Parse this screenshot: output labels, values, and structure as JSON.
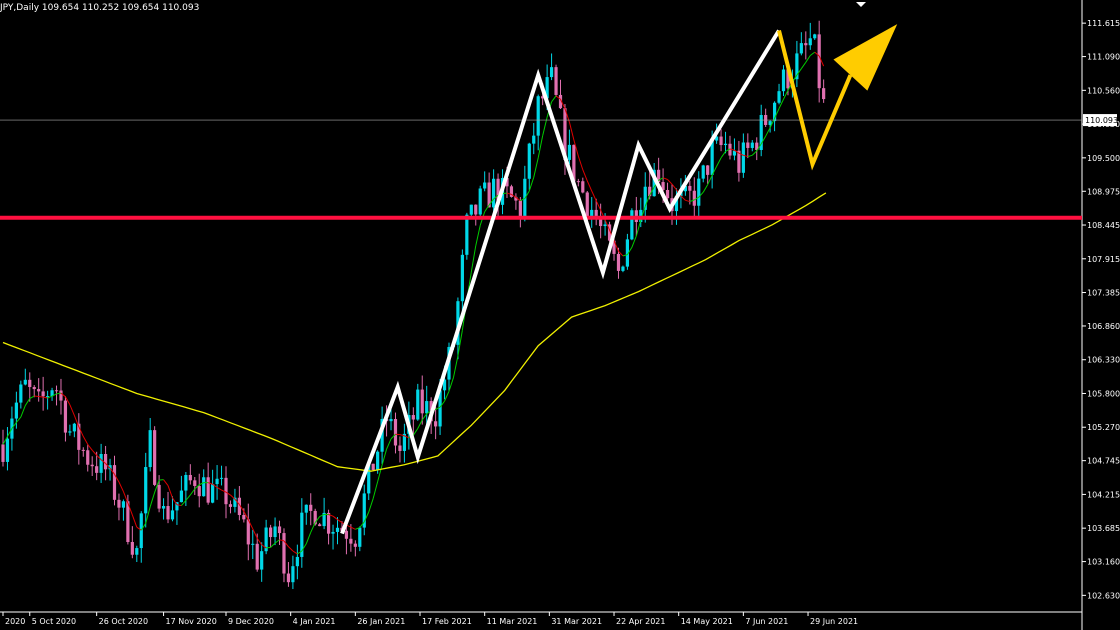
{
  "header": {
    "symbol_line": "JPY,Daily  109.654 110.252 109.654 110.093"
  },
  "chart_data": {
    "type": "candlestick",
    "title": "",
    "xlabel": "",
    "ylabel": "",
    "ylim": [
      102.4,
      111.9
    ],
    "grid": false,
    "background": "#000000",
    "colors": {
      "bull": "#00d8e8",
      "bear": "#e070b0",
      "ma_fast_up": "#00cc00",
      "ma_fast_down": "#e00000",
      "ma_slow": "#f0f000",
      "support": "#ff1040",
      "pattern": "#ffffff",
      "projection": "#ffcc00",
      "axis": "#ffffff"
    },
    "y_ticks": [
      "111.615",
      "111.090",
      "110.560",
      "110.030",
      "109.500",
      "108.975",
      "108.445",
      "107.915",
      "107.385",
      "106.860",
      "106.330",
      "105.800",
      "105.270",
      "104.745",
      "104.215",
      "103.685",
      "103.160",
      "102.630"
    ],
    "current_price": "110.093",
    "x_ticks": [
      {
        "i": 0,
        "label": "2020"
      },
      {
        "i": 12,
        "label": "5 Oct 2020"
      },
      {
        "i": 42,
        "label": "26 Oct 2020"
      },
      {
        "i": 72,
        "label": "17 Nov 2020"
      },
      {
        "i": 100,
        "label": "9 Dec 2020"
      },
      {
        "i": 129,
        "label": "4 Jan 2021"
      },
      {
        "i": 158,
        "label": "26 Jan 2021"
      },
      {
        "i": 187,
        "label": "17 Feb 2021"
      },
      {
        "i": 216,
        "label": "11 Mar 2021"
      },
      {
        "i": 245,
        "label": "31 Mar 2021"
      },
      {
        "i": 274,
        "label": "22 Apr 2021"
      },
      {
        "i": 303,
        "label": "14 May 2021"
      },
      {
        "i": 332,
        "label": "7 Jun 2021"
      },
      {
        "i": 361,
        "label": "29 Jun 2021"
      }
    ],
    "anchors": [
      {
        "i": 0,
        "p": 105.0
      },
      {
        "i": 4,
        "p": 105.5
      },
      {
        "i": 10,
        "p": 105.9
      },
      {
        "i": 16,
        "p": 105.6
      },
      {
        "i": 23,
        "p": 106.0
      },
      {
        "i": 30,
        "p": 105.2
      },
      {
        "i": 38,
        "p": 104.8
      },
      {
        "i": 46,
        "p": 104.6
      },
      {
        "i": 52,
        "p": 104.1
      },
      {
        "i": 60,
        "p": 103.3
      },
      {
        "i": 66,
        "p": 105.0
      },
      {
        "i": 72,
        "p": 103.9
      },
      {
        "i": 78,
        "p": 104.1
      },
      {
        "i": 86,
        "p": 104.5
      },
      {
        "i": 92,
        "p": 104.3
      },
      {
        "i": 100,
        "p": 104.2
      },
      {
        "i": 108,
        "p": 103.7
      },
      {
        "i": 114,
        "p": 103.2
      },
      {
        "i": 122,
        "p": 103.7
      },
      {
        "i": 128,
        "p": 103.0
      },
      {
        "i": 134,
        "p": 103.7
      },
      {
        "i": 140,
        "p": 104.0
      },
      {
        "i": 146,
        "p": 103.8
      },
      {
        "i": 152,
        "p": 103.7
      },
      {
        "i": 158,
        "p": 103.6
      },
      {
        "i": 166,
        "p": 104.7
      },
      {
        "i": 172,
        "p": 105.4
      },
      {
        "i": 178,
        "p": 104.9
      },
      {
        "i": 186,
        "p": 105.6
      },
      {
        "i": 194,
        "p": 105.5
      },
      {
        "i": 202,
        "p": 106.6
      },
      {
        "i": 208,
        "p": 108.4
      },
      {
        "i": 214,
        "p": 108.8
      },
      {
        "i": 220,
        "p": 109.0
      },
      {
        "i": 226,
        "p": 108.9
      },
      {
        "i": 232,
        "p": 108.7
      },
      {
        "i": 240,
        "p": 110.3
      },
      {
        "i": 246,
        "p": 110.7
      },
      {
        "i": 252,
        "p": 109.7
      },
      {
        "i": 258,
        "p": 109.1
      },
      {
        "i": 264,
        "p": 108.7
      },
      {
        "i": 270,
        "p": 108.2
      },
      {
        "i": 276,
        "p": 107.7
      },
      {
        "i": 282,
        "p": 108.6
      },
      {
        "i": 288,
        "p": 109.1
      },
      {
        "i": 294,
        "p": 109.3
      },
      {
        "i": 300,
        "p": 108.8
      },
      {
        "i": 306,
        "p": 108.8
      },
      {
        "i": 312,
        "p": 109.0
      },
      {
        "i": 318,
        "p": 109.6
      },
      {
        "i": 324,
        "p": 109.7
      },
      {
        "i": 330,
        "p": 109.4
      },
      {
        "i": 336,
        "p": 109.7
      },
      {
        "i": 342,
        "p": 110.1
      },
      {
        "i": 348,
        "p": 110.6
      },
      {
        "i": 354,
        "p": 110.9
      },
      {
        "i": 360,
        "p": 111.2
      },
      {
        "i": 363,
        "p": 111.4
      },
      {
        "i": 366,
        "p": 110.7
      },
      {
        "i": 369,
        "p": 110.1
      }
    ],
    "slow_ma": [
      {
        "i": 0,
        "p": 106.6
      },
      {
        "i": 30,
        "p": 106.2
      },
      {
        "i": 60,
        "p": 105.8
      },
      {
        "i": 90,
        "p": 105.5
      },
      {
        "i": 120,
        "p": 105.1
      },
      {
        "i": 150,
        "p": 104.65
      },
      {
        "i": 165,
        "p": 104.58
      },
      {
        "i": 180,
        "p": 104.68
      },
      {
        "i": 195,
        "p": 104.82
      },
      {
        "i": 210,
        "p": 105.3
      },
      {
        "i": 225,
        "p": 105.85
      },
      {
        "i": 240,
        "p": 106.55
      },
      {
        "i": 255,
        "p": 107.0
      },
      {
        "i": 270,
        "p": 107.18
      },
      {
        "i": 285,
        "p": 107.4
      },
      {
        "i": 300,
        "p": 107.65
      },
      {
        "i": 315,
        "p": 107.9
      },
      {
        "i": 330,
        "p": 108.2
      },
      {
        "i": 345,
        "p": 108.45
      },
      {
        "i": 360,
        "p": 108.75
      },
      {
        "i": 369,
        "p": 108.95
      }
    ],
    "support_level": 108.56,
    "pattern_line": [
      {
        "i": 152,
        "p": 103.6
      },
      {
        "i": 177,
        "p": 105.9
      },
      {
        "i": 186,
        "p": 104.8
      },
      {
        "i": 240,
        "p": 110.8
      },
      {
        "i": 269,
        "p": 107.7
      },
      {
        "i": 285,
        "p": 109.7
      },
      {
        "i": 299,
        "p": 108.7
      },
      {
        "i": 348,
        "p": 111.5
      }
    ],
    "projection_line": [
      {
        "i": 348,
        "p": 111.5
      },
      {
        "i": 363,
        "p": 109.4
      },
      {
        "i": 380,
        "p": 110.8
      }
    ],
    "projection_arrow": {
      "tip_i": 401,
      "tip_p": 111.6
    }
  }
}
